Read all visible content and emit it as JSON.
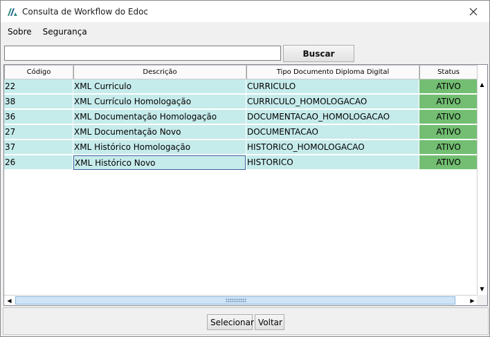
{
  "window": {
    "title": "Consulta de Workflow do Edoc"
  },
  "menu": {
    "items": [
      "Sobre",
      "Segurança"
    ]
  },
  "search": {
    "value": "",
    "button_label": "Buscar"
  },
  "table": {
    "columns": [
      "Código",
      "Descrição",
      "Tipo Documento Diploma Digital",
      "Status"
    ],
    "rows": [
      [
        "22",
        "XML Curriculo",
        "CURRICULO",
        "ATIVO"
      ],
      [
        "38",
        "XML Currículo Homologação",
        "CURRICULO_HOMOLOGACAO",
        "ATIVO"
      ],
      [
        "36",
        "XML Documentação Homologação",
        "DOCUMENTACAO_HOMOLOGACAO",
        "ATIVO"
      ],
      [
        "27",
        "XML Documentação Novo",
        "DOCUMENTACAO",
        "ATIVO"
      ],
      [
        "37",
        "XML Histórico Homologação",
        "HISTORICO_HOMOLOGACAO",
        "ATIVO"
      ],
      [
        "26",
        "XML Histórico Novo",
        "HISTORICO",
        "ATIVO"
      ]
    ]
  },
  "actions": {
    "select_label": "Selecionar",
    "back_label": "Voltar"
  },
  "colors": {
    "row_bg": "#c6ebeb",
    "status_bg": "#73be73"
  },
  "icons": {
    "app": "edoc-logo-icon",
    "close": "close-icon"
  }
}
